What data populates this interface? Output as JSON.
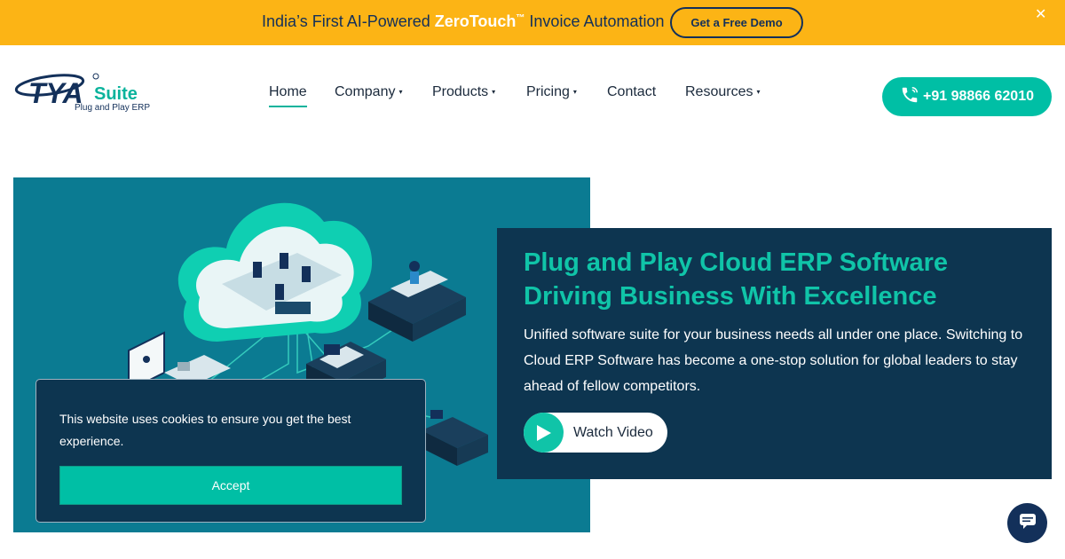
{
  "announcement": {
    "prefix": "India’s First AI-Powered ",
    "highlight": "ZeroTouch",
    "trademark": "™",
    "suffix": " Invoice Automation",
    "cta_label": "Get a Free Demo",
    "close_symbol": "✕"
  },
  "header": {
    "logo_brand": "TYA",
    "logo_word": "Suite",
    "logo_tagline": "Plug and Play ERP",
    "nav": [
      {
        "label": "Home",
        "has_dropdown": false,
        "active": true
      },
      {
        "label": "Company",
        "has_dropdown": true,
        "active": false
      },
      {
        "label": "Products",
        "has_dropdown": true,
        "active": false
      },
      {
        "label": "Pricing",
        "has_dropdown": true,
        "active": false
      },
      {
        "label": "Contact",
        "has_dropdown": false,
        "active": false
      },
      {
        "label": "Resources",
        "has_dropdown": true,
        "active": false
      }
    ],
    "phone": "+91 98866 62010",
    "caret": "▾"
  },
  "hero": {
    "title": "Plug and Play Cloud ERP Software Driving Business With Excellence",
    "description": "Unified software suite for your business needs all under one place. Switching to Cloud ERP Software has become a one-stop solution for global leaders to stay ahead of fellow competitors.",
    "watch_label": "Watch Video"
  },
  "cookie": {
    "message": "This website uses cookies to ensure you get the best experience.",
    "accept_label": "Accept"
  },
  "colors": {
    "announcement_bg": "#fcb415",
    "brand_navy": "#13305a",
    "accent_teal": "#00bfa5",
    "hero_card_bg": "#0d3550"
  }
}
